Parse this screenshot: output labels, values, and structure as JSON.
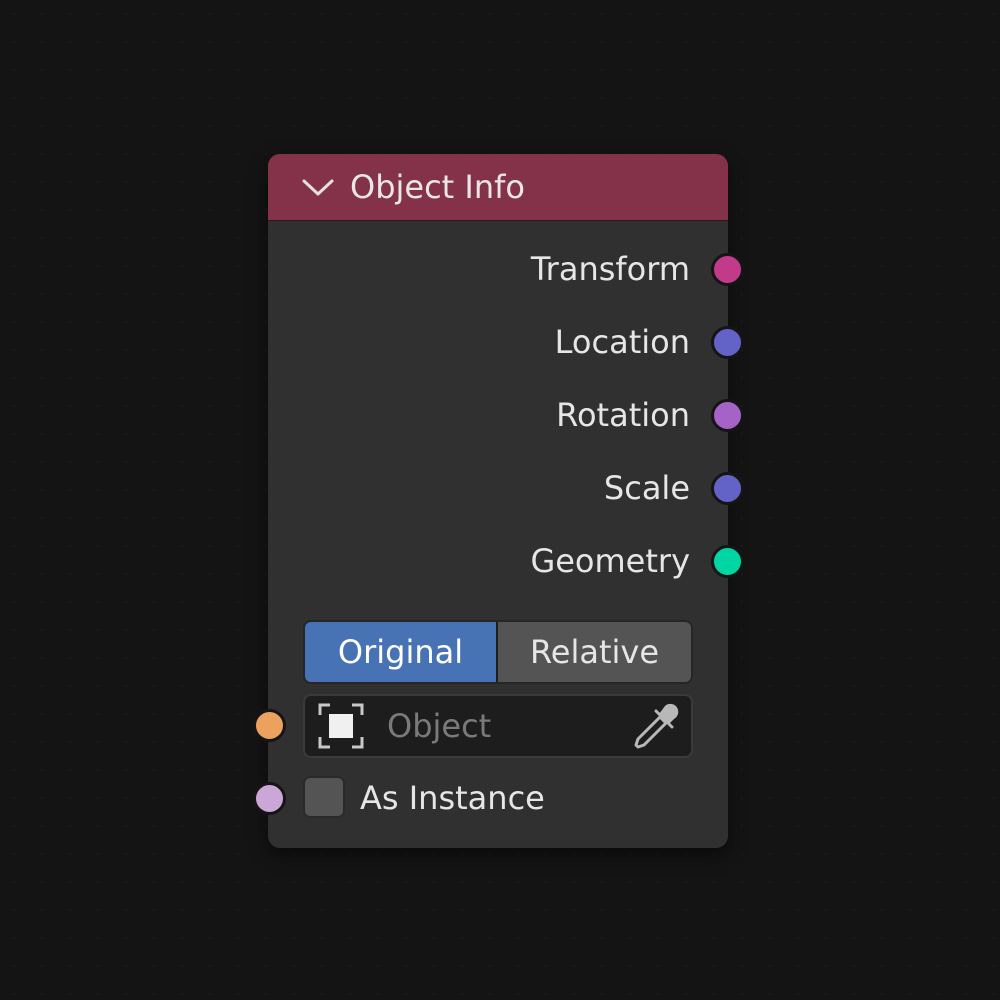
{
  "node": {
    "title": "Object Info",
    "header_color": "#84324a",
    "collapse_icon": "chevron-down-icon"
  },
  "outputs": [
    {
      "label": "Transform",
      "socket_color": "#c13b8a"
    },
    {
      "label": "Location",
      "socket_color": "#6363c7"
    },
    {
      "label": "Rotation",
      "socket_color": "#a563c7"
    },
    {
      "label": "Scale",
      "socket_color": "#6363c7"
    },
    {
      "label": "Geometry",
      "socket_color": "#00d6a3"
    }
  ],
  "transform_space": {
    "options": [
      "Original",
      "Relative"
    ],
    "selected": "Original",
    "accent_color": "#4772b3"
  },
  "object_input": {
    "placeholder": "Object",
    "value": "",
    "socket_color": "#eda15f",
    "icon": "object-icon",
    "picker_icon": "eyedropper-icon"
  },
  "as_instance": {
    "label": "As Instance",
    "checked": false,
    "socket_color": "#cca6d6"
  }
}
